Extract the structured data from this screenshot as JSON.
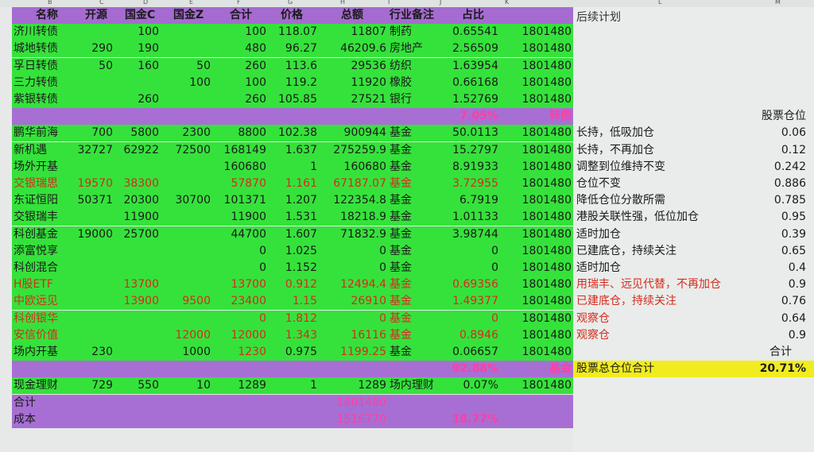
{
  "column_letters": [
    "B",
    "C",
    "D",
    "E",
    "F",
    "G",
    "H",
    "I",
    "J",
    "K",
    "L",
    "M"
  ],
  "headers": {
    "name": "名称",
    "kaiyuan": "开源",
    "guojinC": "国金C",
    "guojinZ": "国金Z",
    "total": "合计",
    "price": "价格",
    "amount": "总额",
    "industry": "行业备注",
    "ratio": "占比",
    "plan": "后续计划"
  },
  "rows": [
    {
      "name": "济川转债",
      "kaiyuan": "",
      "guojinC": "100",
      "guojinZ": "",
      "total": "100",
      "price": "118.07",
      "amount": "11807",
      "industry": "制药",
      "ratio": "0.65541",
      "k": "1801480",
      "plan": "",
      "pos": "",
      "style": "green"
    },
    {
      "name": "城地转债",
      "kaiyuan": "290",
      "guojinC": "190",
      "guojinZ": "",
      "total": "480",
      "price": "96.27",
      "amount": "46209.6",
      "industry": "房地产",
      "ratio": "2.56509",
      "k": "1801480",
      "plan": "",
      "pos": "",
      "style": "green"
    },
    {
      "name": "孚日转债",
      "kaiyuan": "50",
      "guojinC": "160",
      "guojinZ": "50",
      "total": "260",
      "price": "113.6",
      "amount": "29536",
      "industry": "纺织",
      "ratio": "1.63954",
      "k": "1801480",
      "plan": "",
      "pos": "",
      "style": "green"
    },
    {
      "name": "三力转债",
      "kaiyuan": "",
      "guojinC": "",
      "guojinZ": "100",
      "total": "100",
      "price": "119.2",
      "amount": "11920",
      "industry": "橡胶",
      "ratio": "0.66168",
      "k": "1801480",
      "plan": "",
      "pos": "",
      "style": "green"
    },
    {
      "name": "紫银转债",
      "kaiyuan": "",
      "guojinC": "260",
      "guojinZ": "",
      "total": "260",
      "price": "105.85",
      "amount": "27521",
      "industry": "银行",
      "ratio": "1.52769",
      "k": "1801480",
      "plan": "",
      "pos": "",
      "style": "green"
    },
    {
      "name": "",
      "kaiyuan": "",
      "guojinC": "",
      "guojinZ": "",
      "total": "",
      "price": "",
      "amount": "",
      "industry": "",
      "ratio": "7.05%",
      "k": "转债",
      "plan": "",
      "pos": "股票仓位",
      "style": "purple"
    },
    {
      "name": "鹏华前海",
      "kaiyuan": "700",
      "guojinC": "5800",
      "guojinZ": "2300",
      "total": "8800",
      "price": "102.38",
      "amount": "900944",
      "industry": "基金",
      "ratio": "50.0113",
      "k": "1801480",
      "plan": "长持，低吸加仓",
      "pos": "0.06",
      "style": "green"
    },
    {
      "name": "新机遇",
      "kaiyuan": "32727",
      "guojinC": "62922",
      "guojinZ": "72500",
      "total": "168149",
      "price": "1.637",
      "amount": "275259.9",
      "industry": "基金",
      "ratio": "15.2797",
      "k": "1801480",
      "plan": "长持，不再加仓",
      "pos": "0.12",
      "style": "green"
    },
    {
      "name": "场外开基",
      "kaiyuan": "",
      "guojinC": "",
      "guojinZ": "",
      "total": "160680",
      "price": "1",
      "amount": "160680",
      "industry": "基金",
      "ratio": "8.91933",
      "k": "1801480",
      "plan": "调整到位维持不变",
      "pos": "0.242",
      "style": "green"
    },
    {
      "name": "交银瑞思",
      "kaiyuan": "19570",
      "guojinC": "38300",
      "guojinZ": "",
      "total": "57870",
      "price": "1.161",
      "amount": "67187.07",
      "industry": "基金",
      "ratio": "3.72955",
      "k": "1801480",
      "plan": "仓位不变",
      "pos": "0.886",
      "style": "green",
      "red": true
    },
    {
      "name": "东证恒阳",
      "kaiyuan": "50371",
      "guojinC": "20300",
      "guojinZ": "30700",
      "total": "101371",
      "price": "1.207",
      "amount": "122354.8",
      "industry": "基金",
      "ratio": "6.7919",
      "k": "1801480",
      "plan": "降低仓位分散所需",
      "pos": "0.785",
      "style": "green"
    },
    {
      "name": "交银瑞丰",
      "kaiyuan": "",
      "guojinC": "11900",
      "guojinZ": "",
      "total": "11900",
      "price": "1.531",
      "amount": "18218.9",
      "industry": "基金",
      "ratio": "1.01133",
      "k": "1801480",
      "plan": "港股关联性强，低位加仓",
      "pos": "0.95",
      "style": "green"
    },
    {
      "name": "科创基金",
      "kaiyuan": "19000",
      "guojinC": "25700",
      "guojinZ": "",
      "total": "44700",
      "price": "1.607",
      "amount": "71832.9",
      "industry": "基金",
      "ratio": "3.98744",
      "k": "1801480",
      "plan": "适时加仓",
      "pos": "0.39",
      "style": "green"
    },
    {
      "name": "添富悦享",
      "kaiyuan": "",
      "guojinC": "",
      "guojinZ": "",
      "total": "0",
      "price": "1.025",
      "amount": "0",
      "industry": "基金",
      "ratio": "0",
      "k": "1801480",
      "plan": "已建底仓，持续关注",
      "pos": "0.65",
      "style": "green"
    },
    {
      "name": "科创混合",
      "kaiyuan": "",
      "guojinC": "",
      "guojinZ": "",
      "total": "0",
      "price": "1.152",
      "amount": "0",
      "industry": "基金",
      "ratio": "0",
      "k": "1801480",
      "plan": "适时加仓",
      "pos": "0.4",
      "style": "green"
    },
    {
      "name": "H股ETF",
      "kaiyuan": "",
      "guojinC": "13700",
      "guojinZ": "",
      "total": "13700",
      "price": "0.912",
      "amount": "12494.4",
      "industry": "基金",
      "ratio": "0.69356",
      "k": "1801480",
      "plan": "用瑞丰、远见代替，不再加仓",
      "pos": "0.9",
      "style": "green",
      "red": true,
      "redPlan": true
    },
    {
      "name": "中欧远见",
      "kaiyuan": "",
      "guojinC": "13900",
      "guojinZ": "9500",
      "total": "23400",
      "price": "1.15",
      "amount": "26910",
      "industry": "基金",
      "ratio": "1.49377",
      "k": "1801480",
      "plan": "已建底仓，持续关注",
      "pos": "0.76",
      "style": "green",
      "red": true,
      "redPlan": true
    },
    {
      "name": "科创银华",
      "kaiyuan": "",
      "guojinC": "",
      "guojinZ": "",
      "total": "0",
      "price": "1.812",
      "amount": "0",
      "industry": "基金",
      "ratio": "0",
      "k": "1801480",
      "plan": "观察仓",
      "pos": "0.64",
      "style": "green",
      "red": true,
      "redPlan": true
    },
    {
      "name": "安信价值",
      "kaiyuan": "",
      "guojinC": "",
      "guojinZ": "12000",
      "total": "12000",
      "price": "1.343",
      "amount": "16116",
      "industry": "基金",
      "ratio": "0.8946",
      "k": "1801480",
      "plan": "观察仓",
      "pos": "0.9",
      "style": "green",
      "red": true,
      "redPlan": true
    },
    {
      "name": "场内开基",
      "kaiyuan": "230",
      "guojinC": "",
      "guojinZ": "1000",
      "total": "1230",
      "price": "0.975",
      "amount": "1199.25",
      "industry": "基金",
      "ratio": "0.06657",
      "k": "1801480",
      "plan": "",
      "pos": "",
      "style": "green",
      "redPart": true
    },
    {
      "name": "",
      "kaiyuan": "",
      "guojinC": "",
      "guojinZ": "",
      "total": "",
      "price": "",
      "amount": "",
      "industry": "",
      "ratio": "92.88%",
      "k": "基金",
      "plan": "股票总仓位合计",
      "pos": "20.71%",
      "style": "purple",
      "posLabel": "合计"
    },
    {
      "name": "现金理财",
      "kaiyuan": "729",
      "guojinC": "550",
      "guojinZ": "10",
      "total": "1289",
      "price": "1",
      "amount": "1289",
      "industry": "场内理财",
      "ratio": "0.07%",
      "k": "1801480",
      "plan": "",
      "pos": "",
      "style": "green"
    },
    {
      "name": "合计",
      "kaiyuan": "",
      "guojinC": "",
      "guojinZ": "",
      "total": "",
      "price": "",
      "amount": "1801480",
      "industry": "",
      "ratio": "",
      "k": "",
      "plan": "",
      "pos": "",
      "style": "purple",
      "pinkAmount": true
    },
    {
      "name": "成本",
      "kaiyuan": "",
      "guojinC": "",
      "guojinZ": "",
      "total": "",
      "price": "",
      "amount": "1516770",
      "industry": "",
      "ratio": "18.77%",
      "k": "",
      "plan": "",
      "pos": "",
      "style": "purple",
      "pinkAmount": true,
      "pinkRatio": true
    }
  ]
}
